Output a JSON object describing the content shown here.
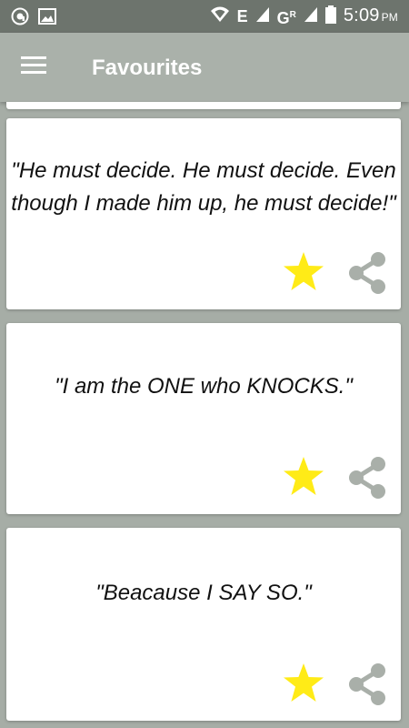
{
  "status_bar": {
    "network_label": "E",
    "network_label_2": "G",
    "network_label_sup": "R",
    "time": "5:09",
    "ampm": "PM",
    "icons": [
      "app-circle-icon",
      "image-icon",
      "wifi-icon",
      "signal-icon",
      "signal-icon",
      "battery-icon"
    ]
  },
  "app_bar": {
    "title": "Favourites",
    "menu_icon": "hamburger-menu-icon"
  },
  "colors": {
    "app_bar": "#aab1aa",
    "status_bar": "#6d746d",
    "background": "#a6ada6",
    "card": "#ffffff",
    "star": "#ffeb17",
    "share_icon": "#a9afa9"
  },
  "quotes": [
    {
      "text": "\"He must decide. He must decide. Even though I made him up, he must decide!\"",
      "favourite_icon": "star-icon",
      "share_icon": "share-icon"
    },
    {
      "text": "\"I am the ONE who KNOCKS.\"",
      "favourite_icon": "star-icon",
      "share_icon": "share-icon"
    },
    {
      "text": "\"Beacause I SAY SO.\"",
      "favourite_icon": "star-icon",
      "share_icon": "share-icon"
    }
  ]
}
